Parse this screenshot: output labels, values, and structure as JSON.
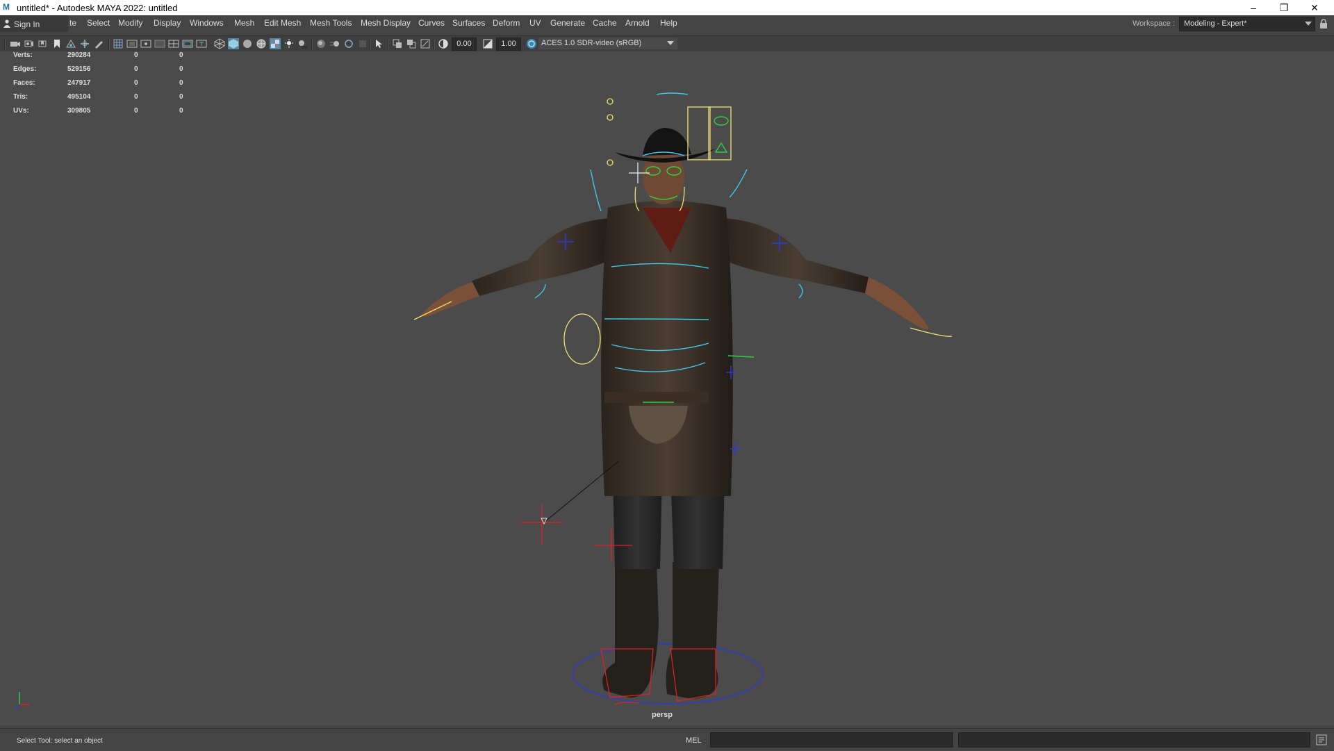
{
  "window": {
    "title": "untitled* - Autodesk MAYA 2022: untitled",
    "controls": [
      "–",
      "❐",
      "✕"
    ]
  },
  "menubar": {
    "sign_in": "Sign In",
    "items": [
      "te",
      "Select",
      "Modify",
      "Display",
      "Windows",
      "Mesh",
      "Edit Mesh",
      "Mesh Tools",
      "Mesh Display",
      "Curves",
      "Surfaces",
      "Deform",
      "UV",
      "Generate",
      "Cache",
      "Arnold",
      "Help"
    ],
    "workspace_label": "Workspace :",
    "workspace_value": "Modeling - Expert*"
  },
  "toolbar": {
    "exposure": "0.00",
    "gamma": "1.00",
    "color_space": "ACES 1.0 SDR-video (sRGB)"
  },
  "hud": {
    "rows": [
      {
        "label": "Verts:",
        "v1": "290284",
        "v2": "0",
        "v3": "0"
      },
      {
        "label": "Edges:",
        "v1": "529156",
        "v2": "0",
        "v3": "0"
      },
      {
        "label": "Faces:",
        "v1": "247917",
        "v2": "0",
        "v3": "0"
      },
      {
        "label": "Tris:",
        "v1": "495104",
        "v2": "0",
        "v3": "0"
      },
      {
        "label": "UVs:",
        "v1": "309805",
        "v2": "0",
        "v3": "0"
      }
    ]
  },
  "viewport": {
    "camera_label": "persp",
    "colors": {
      "background": "#4b4b4b",
      "rig_cyan": "#3ec8e8",
      "rig_yellow": "#f0e070",
      "rig_red": "#e02020",
      "rig_blue": "#2a3ad8",
      "rig_green": "#30d040"
    }
  },
  "statusbar": {
    "help_text": "Select Tool: select an object",
    "language": "MEL"
  }
}
